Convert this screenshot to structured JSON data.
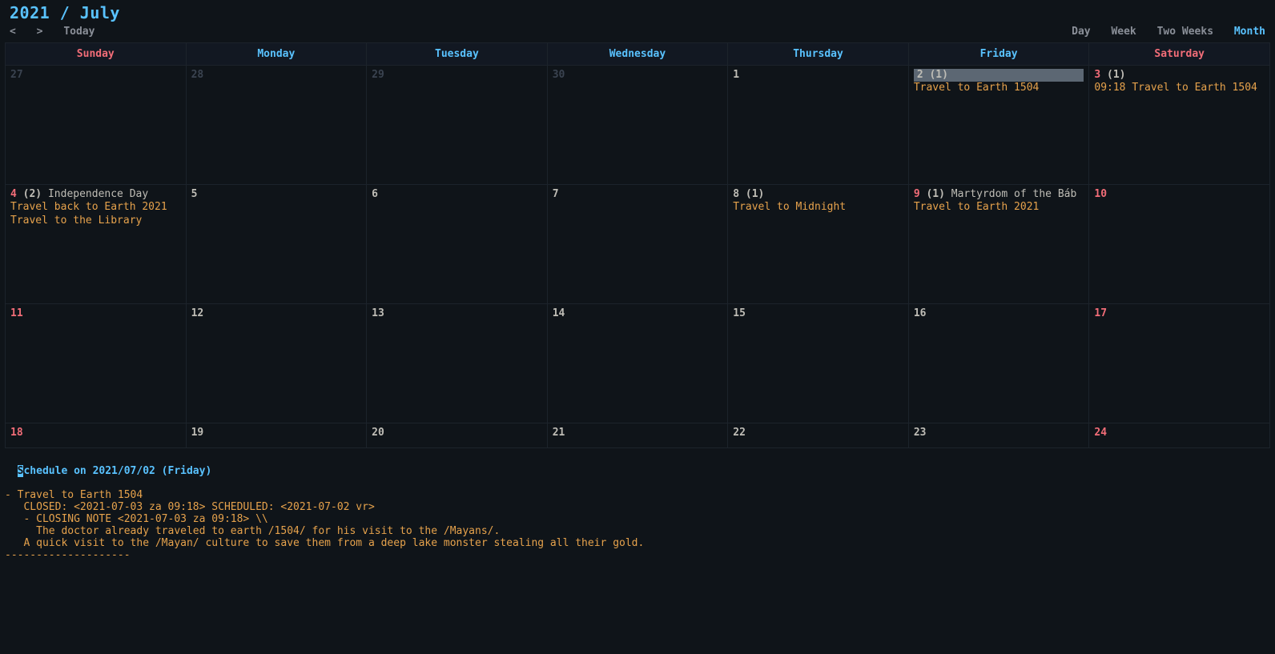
{
  "header": {
    "title": "2021 / July",
    "nav_prev": "<",
    "nav_next": ">",
    "nav_today": "Today",
    "view_day": "Day",
    "view_week": "Week",
    "view_two_weeks": "Two Weeks",
    "view_month": "Month",
    "active_view": "Month"
  },
  "weekdays": {
    "sun": "Sunday",
    "mon": "Monday",
    "tue": "Tuesday",
    "wed": "Wednesday",
    "thu": "Thursday",
    "fri": "Friday",
    "sat": "Saturday"
  },
  "weeks": [
    {
      "cells": [
        {
          "day": "27",
          "muted": true,
          "weekend": true
        },
        {
          "day": "28",
          "muted": true
        },
        {
          "day": "29",
          "muted": true
        },
        {
          "day": "30",
          "muted": true
        },
        {
          "day": "1"
        },
        {
          "day": "2",
          "count": "(1)",
          "selected": true,
          "events": [
            {
              "text": "Travel to Earth 1504"
            }
          ]
        },
        {
          "day": "3",
          "count": "(1)",
          "weekend": true,
          "events": [
            {
              "text": "09:18 Travel to Earth 1504"
            }
          ]
        }
      ]
    },
    {
      "cells": [
        {
          "day": "4",
          "count": "(2)",
          "holiday": "Independence Day",
          "weekend": true,
          "events": [
            {
              "text": "Travel back to Earth 2021"
            },
            {
              "text": "Travel to the Library"
            }
          ]
        },
        {
          "day": "5"
        },
        {
          "day": "6"
        },
        {
          "day": "7"
        },
        {
          "day": "8",
          "count": "(1)",
          "events": [
            {
              "text": "Travel to Midnight"
            }
          ]
        },
        {
          "day": "9",
          "count": "(1)",
          "holiday": "Martyrdom of the Báb",
          "weekend": true,
          "events": [
            {
              "text": "Travel to Earth 2021"
            }
          ]
        },
        {
          "day": "10",
          "weekend": true
        }
      ]
    },
    {
      "cells": [
        {
          "day": "11",
          "weekend": true
        },
        {
          "day": "12"
        },
        {
          "day": "13"
        },
        {
          "day": "14"
        },
        {
          "day": "15"
        },
        {
          "day": "16"
        },
        {
          "day": "17",
          "weekend": true
        }
      ]
    },
    {
      "cells": [
        {
          "day": "18",
          "weekend": true
        },
        {
          "day": "19"
        },
        {
          "day": "20"
        },
        {
          "day": "21"
        },
        {
          "day": "22"
        },
        {
          "day": "23"
        },
        {
          "day": "24",
          "weekend": true
        }
      ]
    }
  ],
  "detail": {
    "heading": "Schedule on 2021/07/02 (Friday)",
    "lines": [
      "",
      "- Travel to Earth 1504",
      "",
      "   CLOSED: <2021-07-03 za 09:18> SCHEDULED: <2021-07-02 vr>",
      "",
      "   - CLOSING NOTE <2021-07-03 za 09:18> \\\\",
      "     The doctor already traveled to earth /1504/ for his visit to the /Mayans/.",
      "",
      "   A quick visit to the /Mayan/ culture to save them from a deep lake monster stealing all their gold.",
      "",
      "--------------------"
    ]
  }
}
